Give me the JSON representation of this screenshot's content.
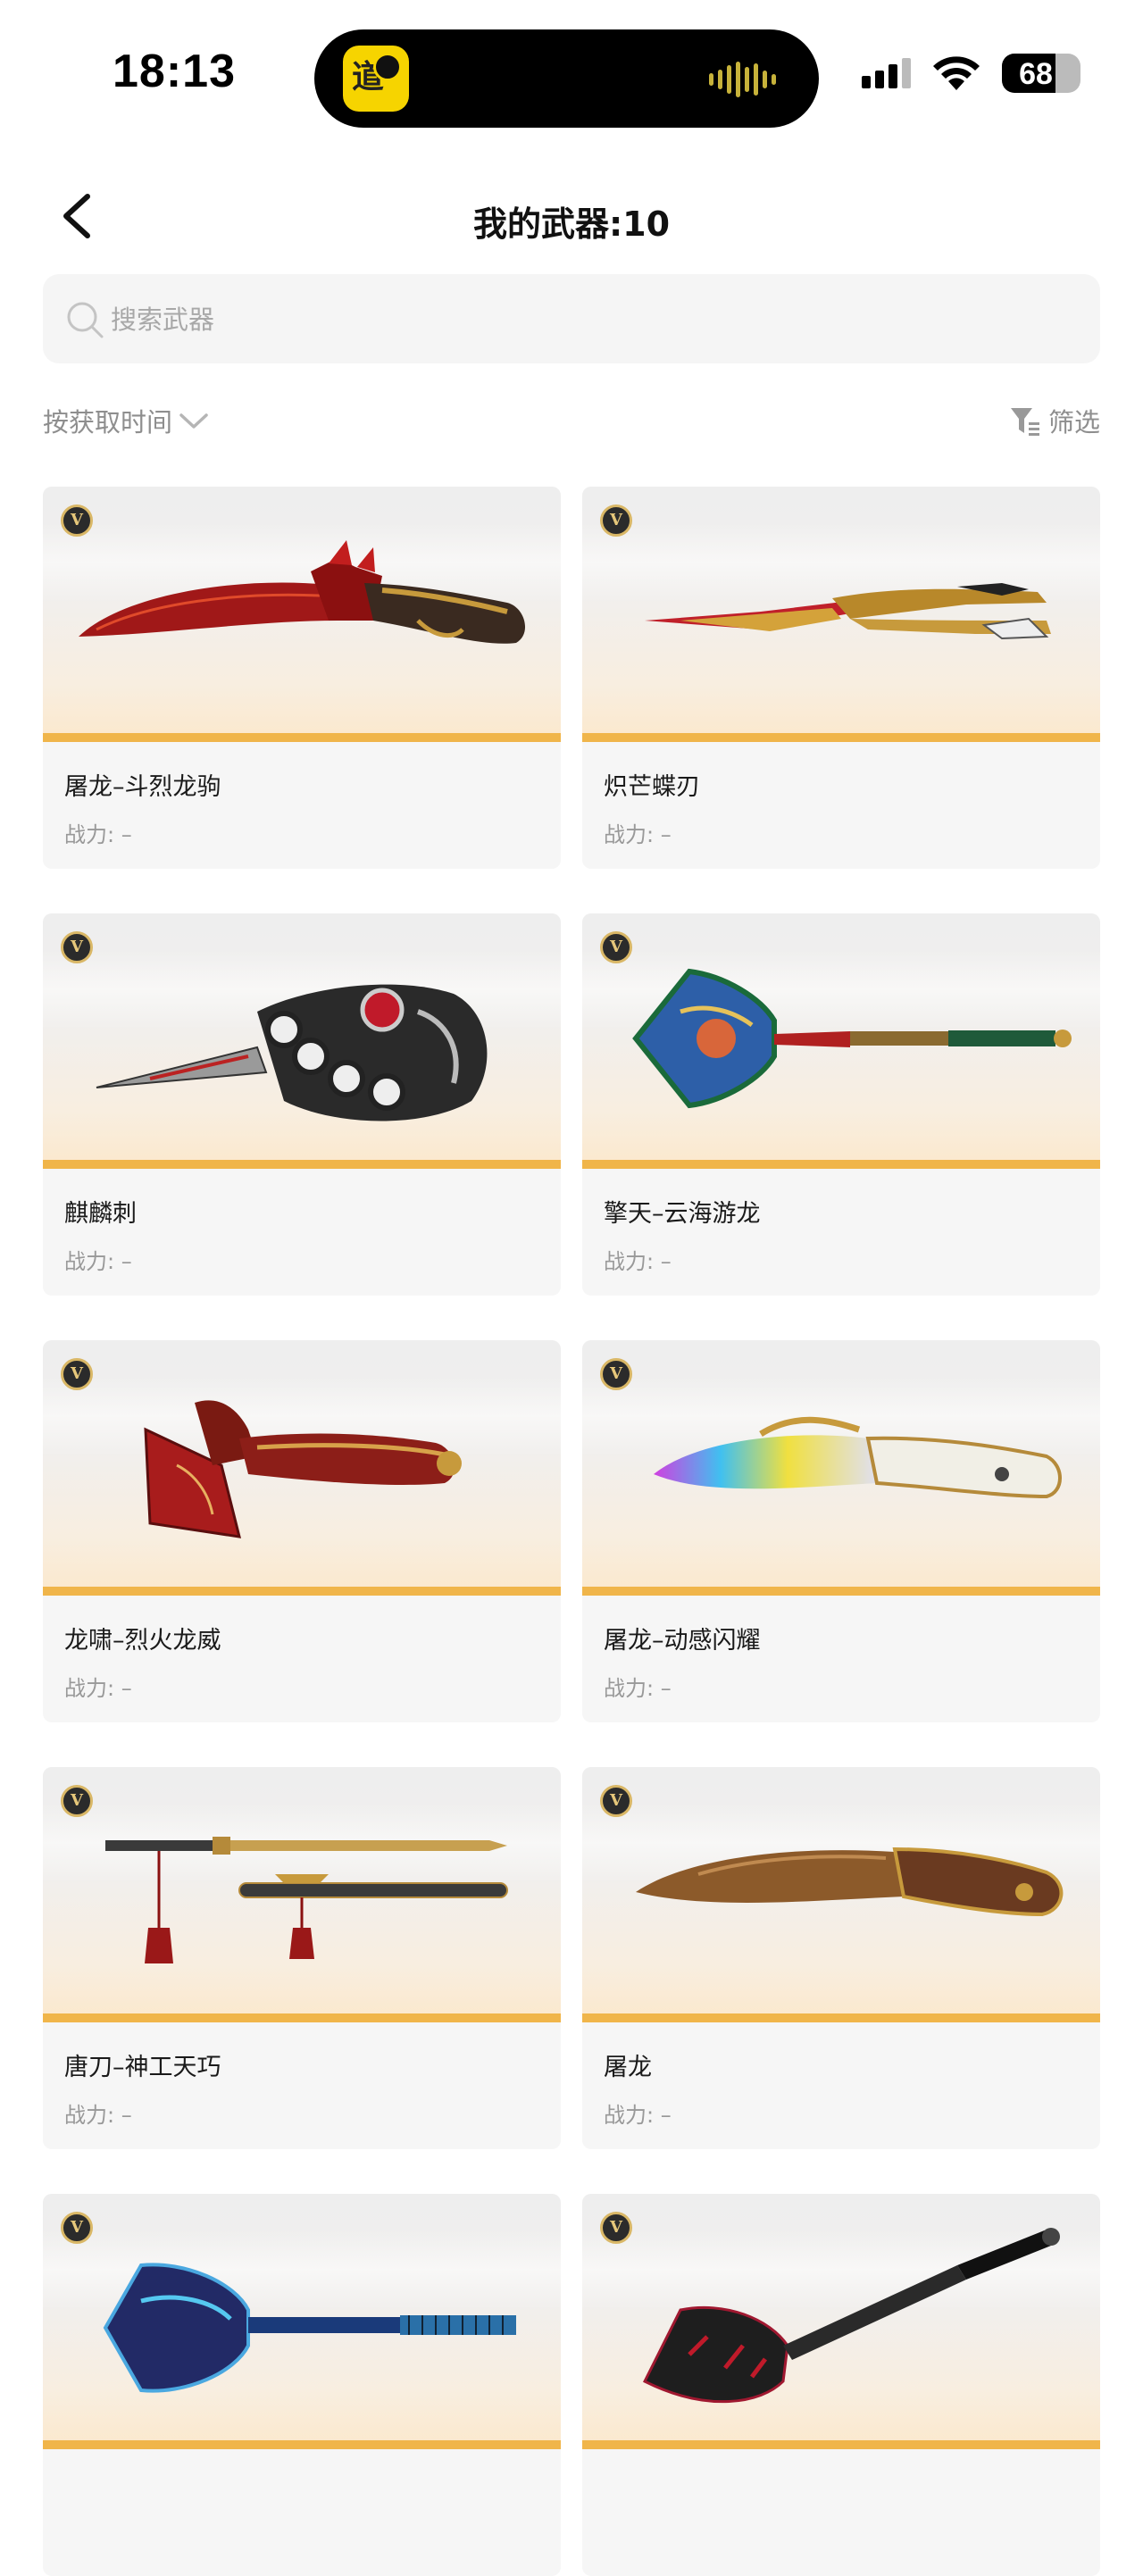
{
  "status_bar": {
    "time": "18:13",
    "battery": "68",
    "battery_level": 0.68,
    "app_icon": "yellow-game-app-icon",
    "app_icon_glyph": "道",
    "icons": [
      "cellular-signal-icon",
      "wifi-icon",
      "battery-icon"
    ]
  },
  "header": {
    "title": "我的武器:10",
    "back_icon": "chevron-left-icon"
  },
  "search": {
    "placeholder": "搜索武器",
    "value": "",
    "icon": "search-icon"
  },
  "toolbar": {
    "sort_label": "按获取时间",
    "sort_icon": "chevron-down-icon",
    "filter_label": "筛选",
    "filter_icon": "filter-icon"
  },
  "colors": {
    "accent_bar": "#f0b54a",
    "card_bg": "#f6f6f6",
    "muted_text": "#999999"
  },
  "weapons": [
    {
      "name": "屠龙–斗烈龙驹",
      "power_label": "战力:",
      "power_value": "–",
      "badge": "V",
      "art": "red-dragon-knife"
    },
    {
      "name": "炽芒蝶刃",
      "power_label": "战力:",
      "power_value": "–",
      "badge": "V",
      "art": "gold-butterfly-knife"
    },
    {
      "name": "麒麟刺",
      "power_label": "战力:",
      "power_value": "–",
      "badge": "V",
      "art": "knuckle-dagger"
    },
    {
      "name": "擎天–云海游龙",
      "power_label": "战力:",
      "power_value": "–",
      "badge": "V",
      "art": "dragon-shovel"
    },
    {
      "name": "龙啸–烈火龙威",
      "power_label": "战力:",
      "power_value": "–",
      "badge": "V",
      "art": "dragon-axe"
    },
    {
      "name": "屠龙–动感闪耀",
      "power_label": "战力:",
      "power_value": "–",
      "badge": "V",
      "art": "holo-dragon-knife"
    },
    {
      "name": "唐刀–神工天巧",
      "power_label": "战力:",
      "power_value": "–",
      "badge": "V",
      "art": "tang-sword"
    },
    {
      "name": "屠龙",
      "power_label": "战力:",
      "power_value": "–",
      "badge": "V",
      "art": "bronze-dragon-knife"
    },
    {
      "name": "",
      "power_label": "",
      "power_value": "",
      "badge": "V",
      "art": "blue-shovel"
    },
    {
      "name": "",
      "power_label": "",
      "power_value": "",
      "badge": "V",
      "art": "black-shovel"
    }
  ]
}
